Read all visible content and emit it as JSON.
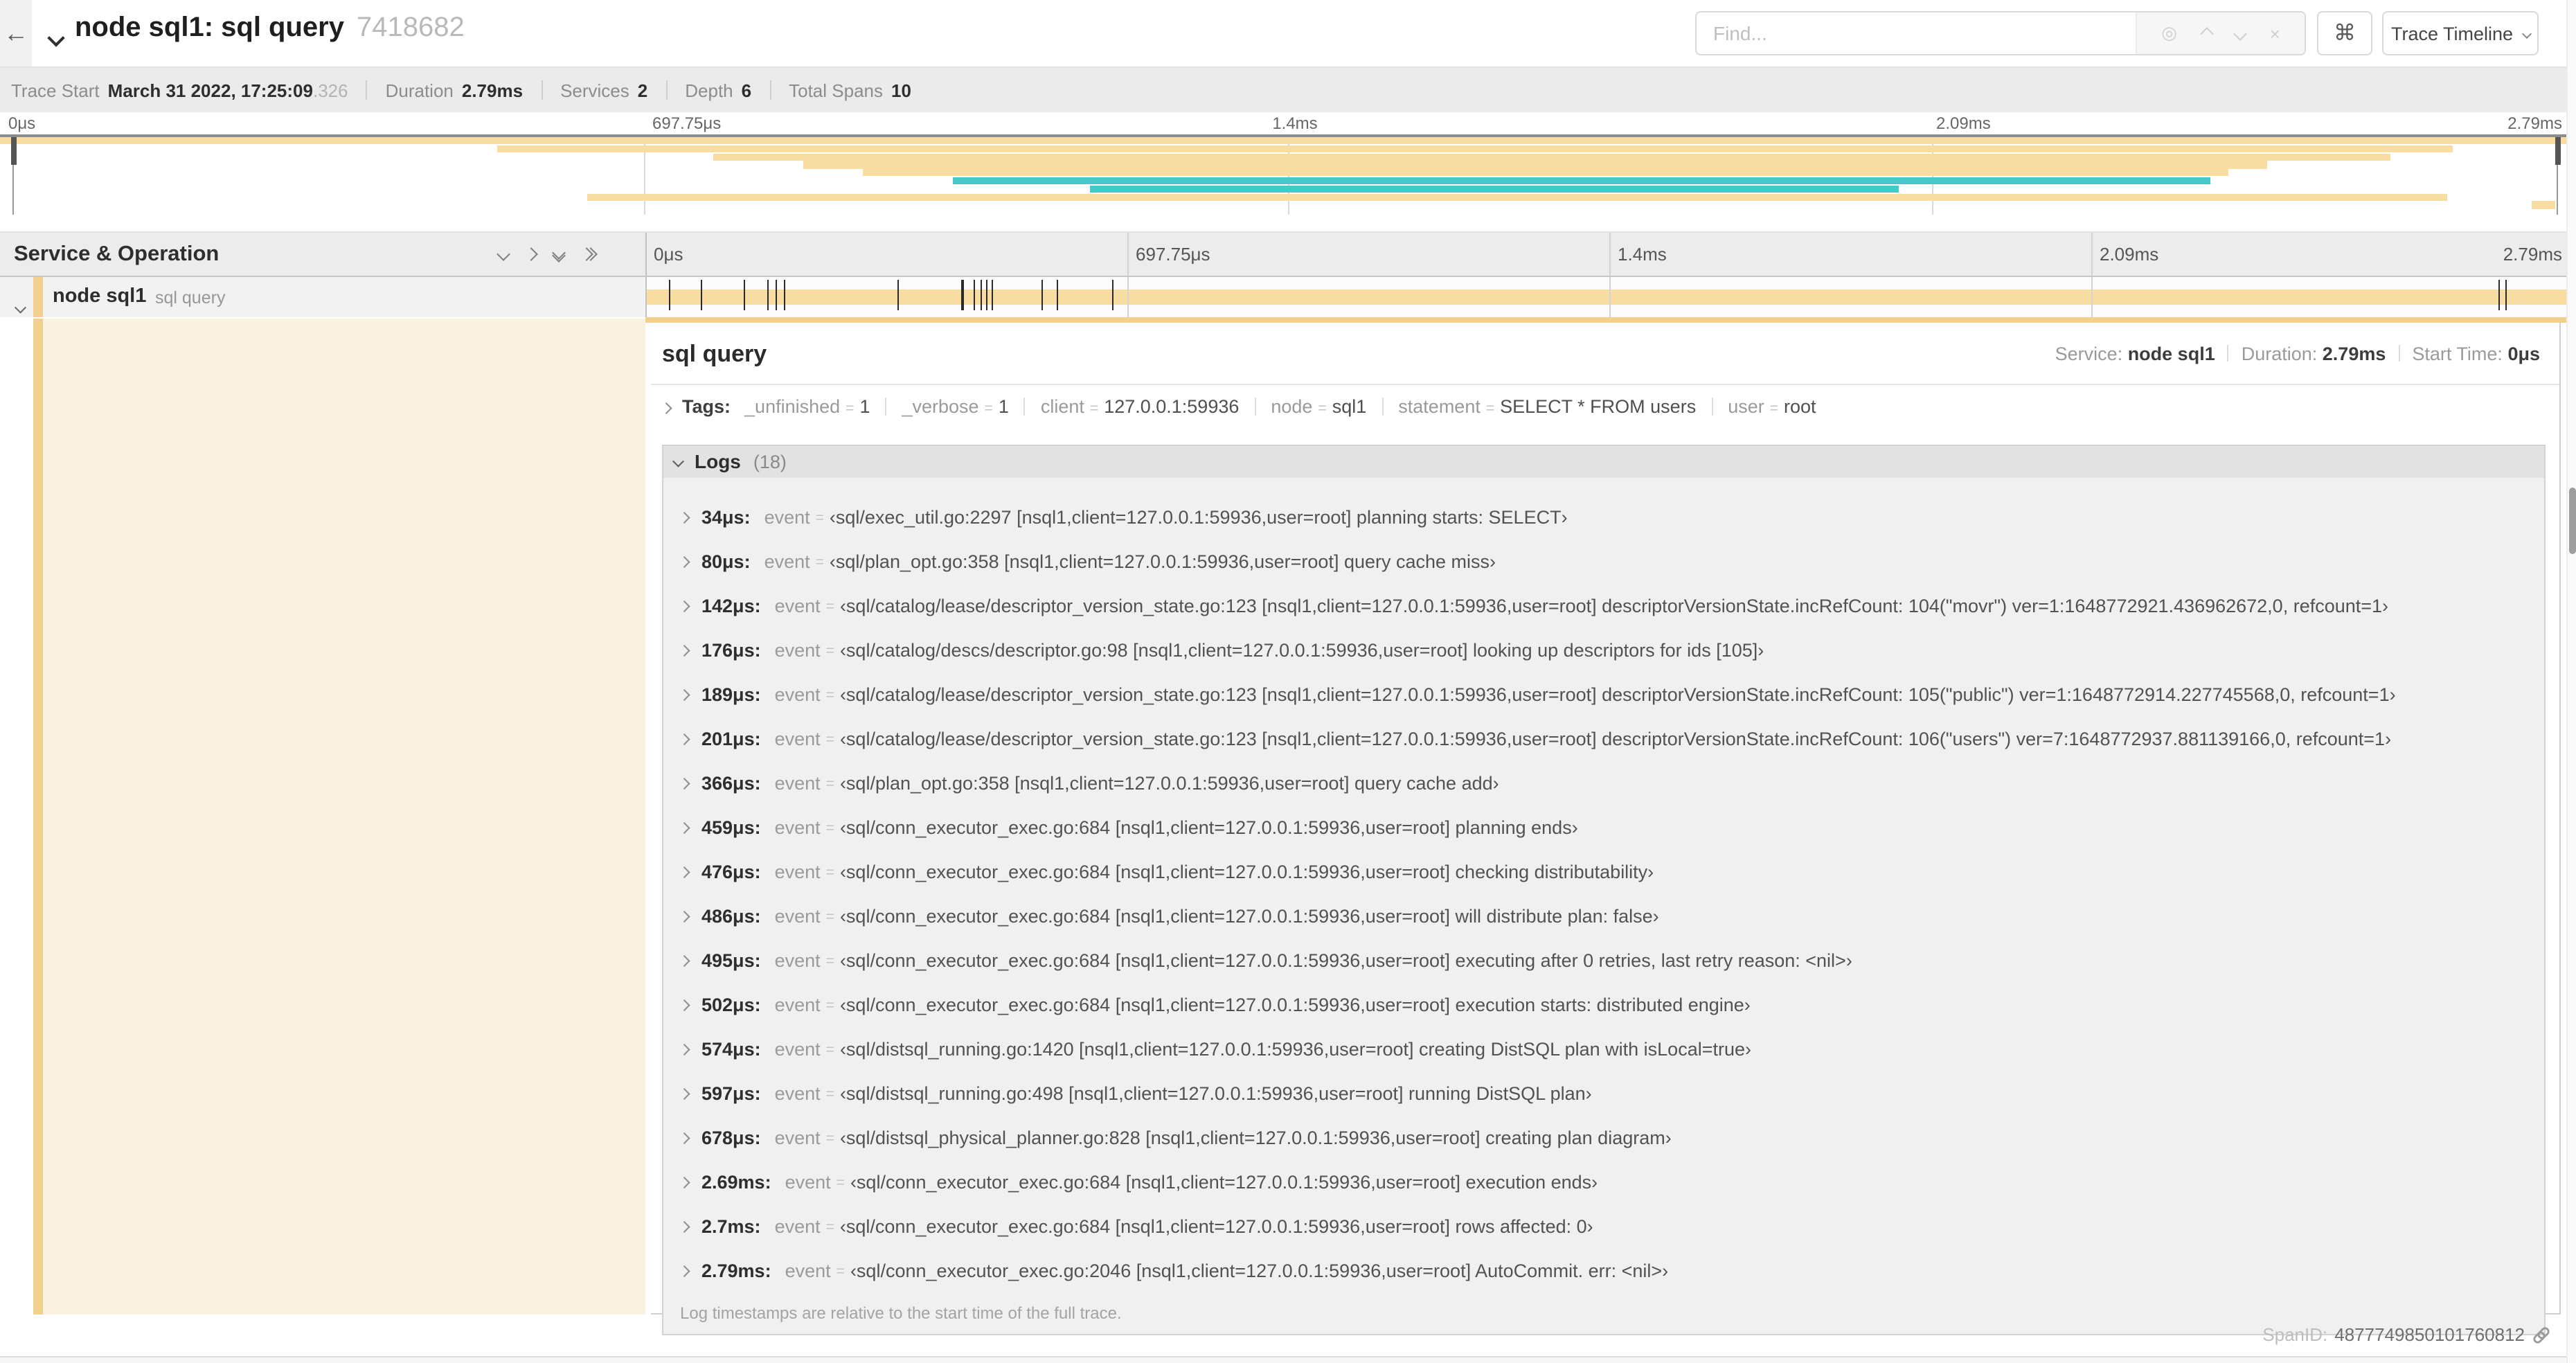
{
  "header": {
    "title": "node sql1: sql query",
    "trace_id": "7418682",
    "find_placeholder": "Find...",
    "shortcut_label": "⌘",
    "view_label": "Trace Timeline",
    "find_tool_icons": [
      "locate-icon",
      "chevron-up-icon",
      "chevron-down-icon",
      "clear-icon"
    ]
  },
  "info_bar": {
    "items": [
      {
        "label": "Trace Start",
        "value": "March 31 2022, 17:25:09",
        "suffix": ".326"
      },
      {
        "label": "Duration",
        "value": "2.79ms"
      },
      {
        "label": "Services",
        "value": "2"
      },
      {
        "label": "Depth",
        "value": "6"
      },
      {
        "label": "Total Spans",
        "value": "10"
      }
    ]
  },
  "minimap": {
    "tick_labels": [
      "0μs",
      "697.75μs",
      "1.4ms",
      "2.09ms",
      "2.79ms"
    ],
    "colors": {
      "tan": "#F7DDA2",
      "teal": "#47C8C8"
    },
    "spans": [
      {
        "start": 0,
        "end": 100,
        "color": "tan"
      },
      {
        "start": 19.3,
        "end": 95.2,
        "color": "tan"
      },
      {
        "start": 27.7,
        "end": 92.8,
        "color": "tan"
      },
      {
        "start": 31.2,
        "end": 88.0,
        "color": "tan"
      },
      {
        "start": 33.5,
        "end": 86.5,
        "color": "tan"
      },
      {
        "start": 37.0,
        "end": 85.8,
        "color": "teal"
      },
      {
        "start": 42.3,
        "end": 73.7,
        "color": "teal"
      },
      {
        "start": 22.8,
        "end": 95.0,
        "color": "tan"
      },
      {
        "start": 98.3,
        "end": 99.2,
        "color": "tan"
      },
      {
        "start": 99.6,
        "end": 100,
        "color": "teal"
      }
    ]
  },
  "timeline": {
    "header_label": "Service & Operation",
    "tick_labels": [
      "0μs",
      "697.75μs",
      "1.4ms",
      "2.09ms",
      "2.79ms"
    ],
    "row": {
      "service": "node sql1",
      "operation": "sql query"
    },
    "row_color": "#F7DDA2",
    "strip_color": "#F2CF8D"
  },
  "detail": {
    "title": "sql query",
    "meta": [
      {
        "label": "Service:",
        "value": "node sql1"
      },
      {
        "label": "Duration:",
        "value": "2.79ms"
      },
      {
        "label": "Start Time:",
        "value": "0μs"
      }
    ],
    "tags_label": "Tags:",
    "tags": [
      {
        "key": "_unfinished",
        "value": "1"
      },
      {
        "key": "_verbose",
        "value": "1"
      },
      {
        "key": "client",
        "value": "127.0.0.1:59936"
      },
      {
        "key": "node",
        "value": "sql1"
      },
      {
        "key": "statement",
        "value": "SELECT * FROM users"
      },
      {
        "key": "user",
        "value": "root"
      }
    ],
    "logs": {
      "label": "Logs",
      "count": "(18)",
      "trace_duration_us": 2790,
      "entries": [
        {
          "time": "34μs:",
          "t_us": 34,
          "key": "event",
          "text": "‹sql/exec_util.go:2297 [nsql1,client=127.0.0.1:59936,user=root] planning starts: SELECT›"
        },
        {
          "time": "80μs:",
          "t_us": 80,
          "key": "event",
          "text": "‹sql/plan_opt.go:358 [nsql1,client=127.0.0.1:59936,user=root] query cache miss›"
        },
        {
          "time": "142μs:",
          "t_us": 142,
          "key": "event",
          "text": "‹sql/catalog/lease/descriptor_version_state.go:123 [nsql1,client=127.0.0.1:59936,user=root] descriptorVersionState.incRefCount: 104(\"movr\") ver=1:1648772921.436962672,0, refcount=1›"
        },
        {
          "time": "176μs:",
          "t_us": 176,
          "key": "event",
          "text": "‹sql/catalog/descs/descriptor.go:98 [nsql1,client=127.0.0.1:59936,user=root] looking up descriptors for ids [105]›"
        },
        {
          "time": "189μs:",
          "t_us": 189,
          "key": "event",
          "text": "‹sql/catalog/lease/descriptor_version_state.go:123 [nsql1,client=127.0.0.1:59936,user=root] descriptorVersionState.incRefCount: 105(\"public\") ver=1:1648772914.227745568,0, refcount=1›"
        },
        {
          "time": "201μs:",
          "t_us": 201,
          "key": "event",
          "text": "‹sql/catalog/lease/descriptor_version_state.go:123 [nsql1,client=127.0.0.1:59936,user=root] descriptorVersionState.incRefCount: 106(\"users\") ver=7:1648772937.881139166,0, refcount=1›"
        },
        {
          "time": "366μs:",
          "t_us": 366,
          "key": "event",
          "text": "‹sql/plan_opt.go:358 [nsql1,client=127.0.0.1:59936,user=root] query cache add›"
        },
        {
          "time": "459μs:",
          "t_us": 459,
          "key": "event",
          "text": "‹sql/conn_executor_exec.go:684 [nsql1,client=127.0.0.1:59936,user=root] planning ends›"
        },
        {
          "time": "476μs:",
          "t_us": 476,
          "key": "event",
          "text": "‹sql/conn_executor_exec.go:684 [nsql1,client=127.0.0.1:59936,user=root] checking distributability›"
        },
        {
          "time": "486μs:",
          "t_us": 486,
          "key": "event",
          "text": "‹sql/conn_executor_exec.go:684 [nsql1,client=127.0.0.1:59936,user=root] will distribute plan: false›"
        },
        {
          "time": "495μs:",
          "t_us": 495,
          "key": "event",
          "text": "‹sql/conn_executor_exec.go:684 [nsql1,client=127.0.0.1:59936,user=root] executing after 0 retries, last retry reason: <nil>›"
        },
        {
          "time": "502μs:",
          "t_us": 502,
          "key": "event",
          "text": "‹sql/conn_executor_exec.go:684 [nsql1,client=127.0.0.1:59936,user=root] execution starts: distributed engine›"
        },
        {
          "time": "574μs:",
          "t_us": 574,
          "key": "event",
          "text": "‹sql/distsql_running.go:1420 [nsql1,client=127.0.0.1:59936,user=root] creating DistSQL plan with isLocal=true›"
        },
        {
          "time": "597μs:",
          "t_us": 597,
          "key": "event",
          "text": "‹sql/distsql_running.go:498 [nsql1,client=127.0.0.1:59936,user=root] running DistSQL plan›"
        },
        {
          "time": "678μs:",
          "t_us": 678,
          "key": "event",
          "text": "‹sql/distsql_physical_planner.go:828 [nsql1,client=127.0.0.1:59936,user=root] creating plan diagram›"
        },
        {
          "time": "2.69ms:",
          "t_us": 2690,
          "key": "event",
          "text": "‹sql/conn_executor_exec.go:684 [nsql1,client=127.0.0.1:59936,user=root] execution ends›"
        },
        {
          "time": "2.7ms:",
          "t_us": 2700,
          "key": "event",
          "text": "‹sql/conn_executor_exec.go:684 [nsql1,client=127.0.0.1:59936,user=root] rows affected: 0›"
        },
        {
          "time": "2.79ms:",
          "t_us": 2790,
          "key": "event",
          "text": "‹sql/conn_executor_exec.go:2046 [nsql1,client=127.0.0.1:59936,user=root] AutoCommit. err: <nil>›"
        }
      ],
      "footer": "Log timestamps are relative to the start time of the full trace."
    }
  },
  "footer": {
    "spanid_label": "SpanID:",
    "spanid": "4877749850101760812"
  }
}
